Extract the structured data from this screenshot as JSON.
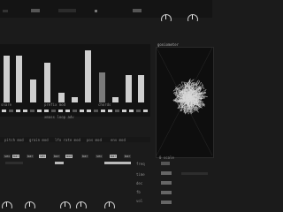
{
  "header": {
    "title": "",
    "left_button": "",
    "right_label": ""
  },
  "bars_panel": {
    "labels": [
      "snare",
      "prefix mod",
      "chords"
    ],
    "sub_label": "xmass loop adv",
    "bar_levels": [
      0.85,
      0.85,
      0.42,
      0.72,
      0.18,
      0.1,
      0.95,
      0.55,
      0.1,
      0.5,
      0.5
    ],
    "bar_dim": [
      false,
      false,
      false,
      false,
      false,
      false,
      false,
      true,
      false,
      false,
      false
    ]
  },
  "goniometer": {
    "title": "goniometer",
    "scale_label": "0 scale"
  },
  "mod_row": {
    "labels": [
      "pitch mod",
      "grain mod",
      "lfo rate mod",
      "pos mod",
      "env mod"
    ]
  },
  "chip_row": {
    "chips": [
      {
        "label": "sec",
        "on": false
      },
      {
        "label": "bar",
        "on": true
      },
      {
        "label": "bar",
        "on": false
      },
      {
        "label": "sec",
        "on": true
      },
      {
        "label": "bar",
        "on": false
      },
      {
        "label": "mod",
        "on": true
      },
      {
        "label": "bar",
        "on": false
      },
      {
        "label": "sec",
        "on": false
      },
      {
        "label": "bar",
        "on": true
      },
      {
        "label": "bar",
        "on": false
      }
    ]
  },
  "right_column": {
    "labels": [
      "freq",
      "time",
      "dec",
      "fb",
      "vol"
    ]
  },
  "footer": {
    "knob_count": 5
  }
}
